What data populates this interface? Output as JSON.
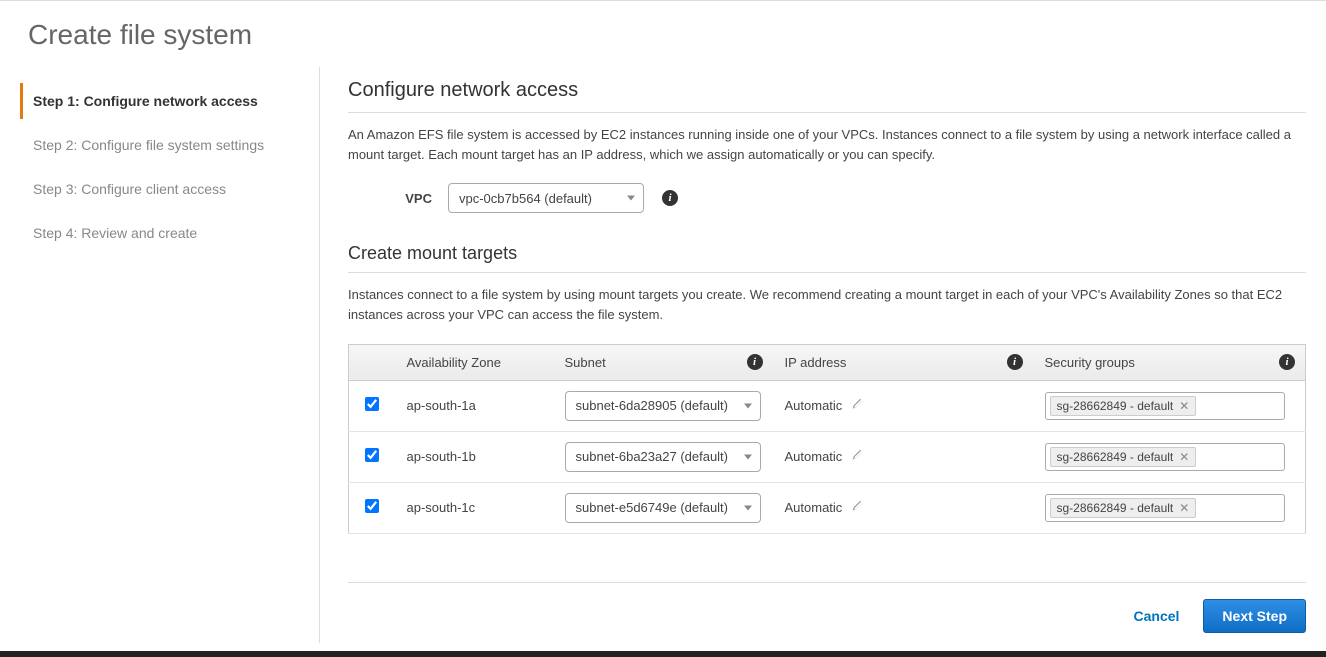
{
  "page_title": "Create file system",
  "sidebar": {
    "steps": [
      {
        "label": "Step 1: Configure network access",
        "active": true
      },
      {
        "label": "Step 2: Configure file system settings",
        "active": false
      },
      {
        "label": "Step 3: Configure client access",
        "active": false
      },
      {
        "label": "Step 4: Review and create",
        "active": false
      }
    ]
  },
  "main": {
    "section1_title": "Configure network access",
    "section1_desc": "An Amazon EFS file system is accessed by EC2 instances running inside one of your VPCs. Instances connect to a file system by using a network interface called a mount target. Each mount target has an IP address, which we assign automatically or you can specify.",
    "vpc_label": "VPC",
    "vpc_selected": "vpc-0cb7b564 (default)",
    "section2_title": "Create mount targets",
    "section2_desc": "Instances connect to a file system by using mount targets you create. We recommend creating a mount target in each of your VPC's Availability Zones so that EC2 instances across your VPC can access the file system.",
    "table": {
      "headers": {
        "az": "Availability Zone",
        "subnet": "Subnet",
        "ip": "IP address",
        "sg": "Security groups"
      },
      "rows": [
        {
          "az": "ap-south-1a",
          "subnet": "subnet-6da28905 (default)",
          "ip": "Automatic",
          "sg": "sg-28662849 - default"
        },
        {
          "az": "ap-south-1b",
          "subnet": "subnet-6ba23a27 (default)",
          "ip": "Automatic",
          "sg": "sg-28662849 - default"
        },
        {
          "az": "ap-south-1c",
          "subnet": "subnet-e5d6749e (default)",
          "ip": "Automatic",
          "sg": "sg-28662849 - default"
        }
      ]
    }
  },
  "footer": {
    "cancel": "Cancel",
    "next": "Next Step"
  }
}
